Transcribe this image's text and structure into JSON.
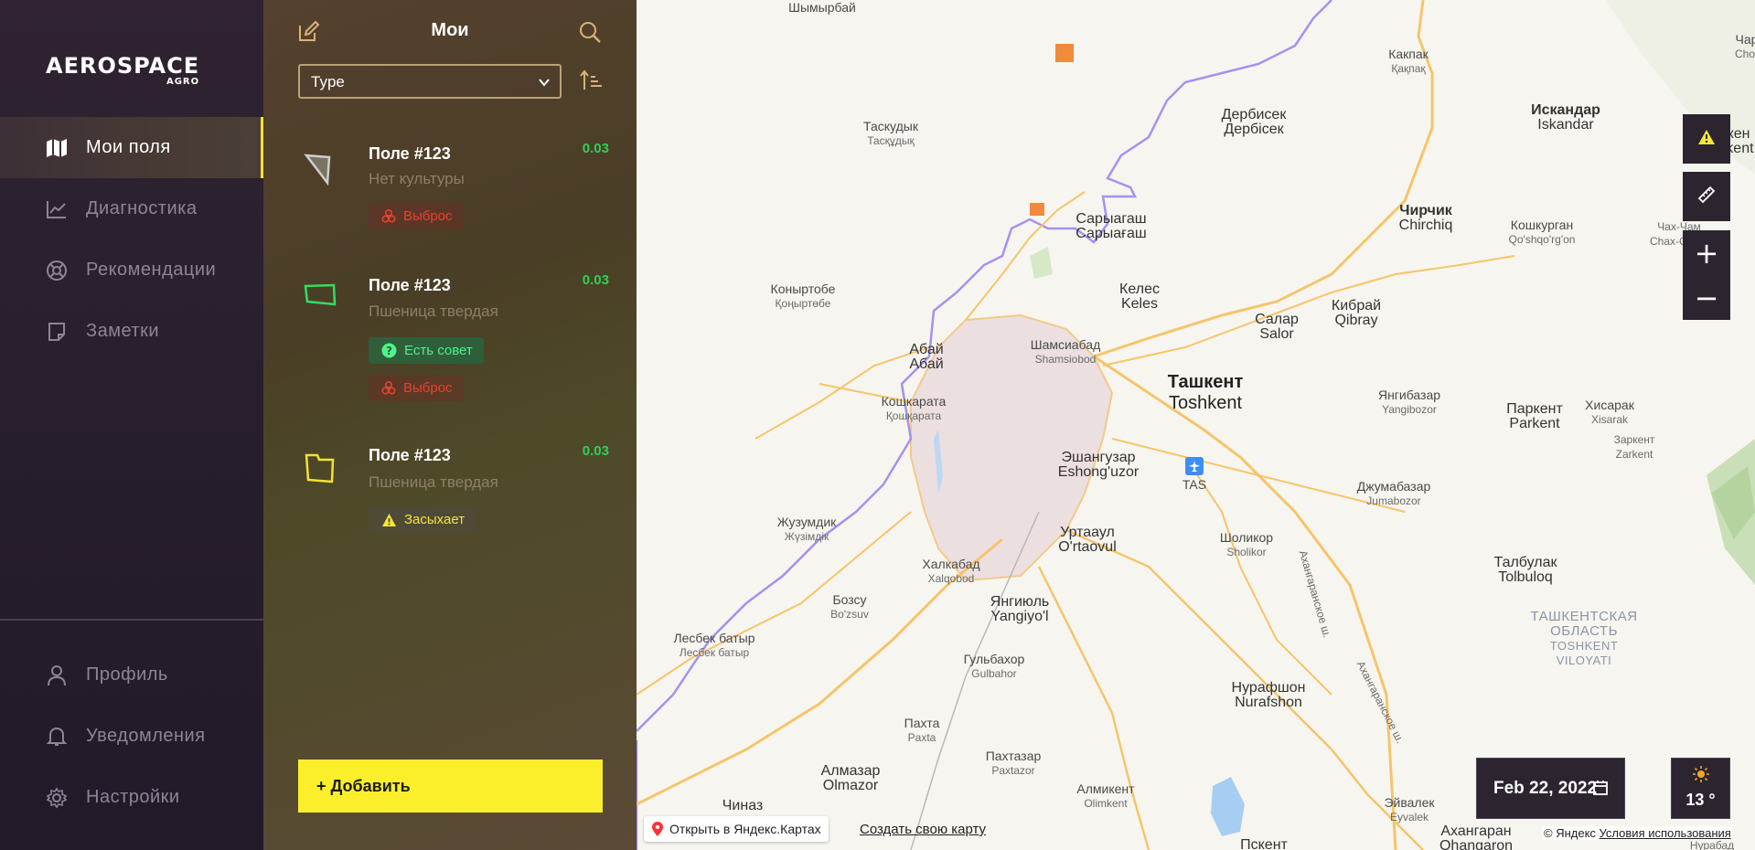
{
  "brand": {
    "name": "AEROSPACE",
    "sub": "AGRO"
  },
  "nav": {
    "items": [
      {
        "label": "Мои поля",
        "icon": "map-icon",
        "active": true
      },
      {
        "label": "Диагностика",
        "icon": "chart-line-icon"
      },
      {
        "label": "Рекомендации",
        "icon": "lifebuoy-icon"
      },
      {
        "label": "Заметки",
        "icon": "note-icon"
      }
    ],
    "bottom": [
      {
        "label": "Профиль",
        "icon": "user-icon"
      },
      {
        "label": "Уведомления",
        "icon": "bell-icon"
      },
      {
        "label": "Настройки",
        "icon": "gear-icon"
      }
    ]
  },
  "panel": {
    "title": "Мои",
    "type_select": "Type",
    "add_label": "+ Добавить",
    "fields": [
      {
        "name": "Поле #123",
        "crop": "Нет культуры",
        "value": "0.03",
        "tags": [
          {
            "label": "Выброс",
            "kind": "red",
            "icon": "biohazard-icon"
          }
        ]
      },
      {
        "name": "Поле #123",
        "crop": "Пшеница твердая",
        "value": "0.03",
        "tags": [
          {
            "label": "Есть совет",
            "kind": "green",
            "icon": "question-icon"
          },
          {
            "label": "Выброс",
            "kind": "red",
            "icon": "biohazard-icon"
          }
        ]
      },
      {
        "name": "Поле #123",
        "crop": "Пшеница твердая",
        "value": "0.03",
        "tags": [
          {
            "label": "Засыхает",
            "kind": "yellow",
            "icon": "warning-icon"
          }
        ]
      }
    ]
  },
  "map": {
    "date": "Feb 22, 2022",
    "temperature": "13 °",
    "open_in_yandex": "Открыть в Яндекс.Картах",
    "create_map": "Создать свою карту",
    "copyright": "© Яндекс",
    "terms": "Условия использования",
    "labels": {
      "shymyrbai": "Шымырбай",
      "kakpak": "Какпак",
      "kakpak2": "Қақпақ",
      "derbisek": "Дербисек",
      "derbisek2": "Дербісек",
      "iskandar": "Искандар",
      "iskandar2": "Iskandar",
      "gazalkent": "Газалкен",
      "gazalkent2": "G'azalkent",
      "char": "Чар",
      "char2": "Chor",
      "taskuduk": "Таскудык",
      "taskuduk2": "Тасқұдық",
      "saryagash": "Сарыагаш",
      "saryagash2": "Сарыағаш",
      "chirchik": "Чирчик",
      "chirchik2": "Chirchiq",
      "koshkurgan": "Кошкурган",
      "koshkurgan2": "Qo'shqo'rg'on",
      "chakhcham": "Чах-Чам",
      "chakhcham2": "Chax-Cham",
      "konyrtobe": "Коныртобе",
      "konyrtobe2": "Қоңыртөбе",
      "keles": "Келес",
      "keles2": "Keles",
      "salar": "Салар",
      "salar2": "Salor",
      "kibray": "Кибрай",
      "kibray2": "Qibray",
      "abay": "Абай",
      "abay2": "Абай",
      "shamsiabad": "Шамсиабад",
      "shamsiabad2": "Shamsiobod",
      "tashkent": "Ташкент",
      "tashkent2": "Toshkent",
      "koshkarata": "Кошкарата",
      "koshkarata2": "Қошқарата",
      "yangibazar": "Янгибазар",
      "yangibazar2": "Yangibozor",
      "parkent": "Паркент",
      "parkent2": "Parkent",
      "khisarak": "Хисарак",
      "khisarak2": "Xisarak",
      "zarkent": "Заркент",
      "zarkent2": "Zarkent",
      "eshanguzar": "Эшангузар",
      "eshanguzar2": "Eshong'uzor",
      "tas": "TAS",
      "jumabazar": "Джумабазар",
      "jumabazar2": "Jumabozor",
      "zhuzumdik": "Жузумдик",
      "zhuzumdik2": "Жүзімдік",
      "urtaaul": "Уртааул",
      "urtaaul2": "O'rtaovul",
      "sholikor": "Шоликор",
      "sholikor2": "Sholikor",
      "khalkabad": "Халкабад",
      "khalkabad2": "Xalqobod",
      "talbulak": "Талбулак",
      "talbulak2": "Tolbuloq",
      "bozsu": "Бозсу",
      "bozsu2": "Bo'zsuv",
      "yangiyul": "Янгиюль",
      "yangiyul2": "Yangiyo'l",
      "region1": "ТАШКЕНТСКАЯ",
      "region2": "ОБЛАСТЬ",
      "region3": "TOSHKENT",
      "region4": "VILOYATI",
      "lesbek": "Лесбек батыр",
      "lesbek2": "Лесбек батыр",
      "gulbakhor": "Гульбахор",
      "gulbakhor2": "Gulbahor",
      "akhangaran_hw": "Ахангаранское ш.",
      "nurafshon": "Нурафшон",
      "nurafshon2": "Nurafshon",
      "pakhta": "Пахта",
      "pakhta2": "Paxta",
      "pakhtazar": "Пахтазар",
      "pakhtazar2": "Paxtazor",
      "almazar": "Алмазар",
      "almazar2": "Olmazor",
      "almikent": "Алмикент",
      "almikent2": "Olimkent",
      "eivalek": "Эйвалек",
      "eivalek2": "Eyvalek",
      "chinaz": "Чиназ",
      "pskent": "Пскент",
      "akhangaran": "Ахангаран",
      "akhangaran2": "Ohangaron",
      "nurabad": "Нурабад"
    }
  }
}
